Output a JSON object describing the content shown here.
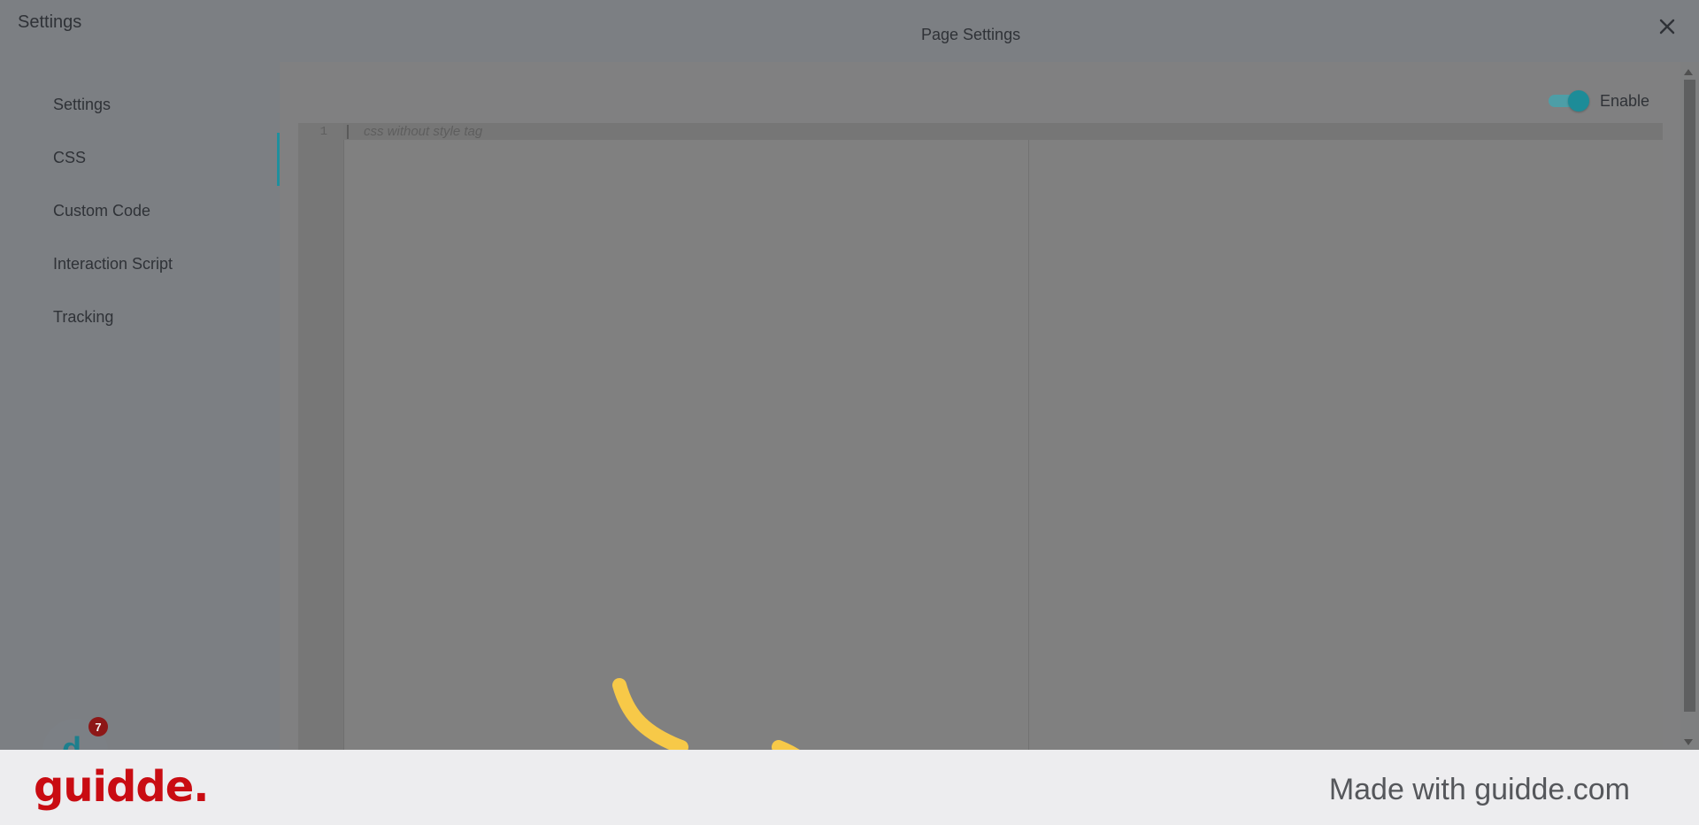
{
  "header": {
    "app_title": "Settings",
    "dialog_title": "Page Settings",
    "close_icon": "close-icon"
  },
  "sidebar": {
    "items": [
      {
        "label": "Settings",
        "active": false
      },
      {
        "label": "CSS",
        "active": true
      },
      {
        "label": "Custom Code",
        "active": false
      },
      {
        "label": "Interaction Script",
        "active": false
      },
      {
        "label": "Tracking",
        "active": false
      }
    ]
  },
  "editor": {
    "enable_toggle": {
      "label": "Enable",
      "on": true
    },
    "line_number": "1",
    "placeholder": "css without style tag"
  },
  "widget": {
    "logo": "d",
    "badge_count": "7"
  },
  "footer": {
    "logo": "guidde.",
    "text": "Made with guidde.com"
  },
  "colors": {
    "accent": "#1D8C98",
    "brand_red": "#C90C12",
    "annotation_yellow": "#F7C948"
  }
}
